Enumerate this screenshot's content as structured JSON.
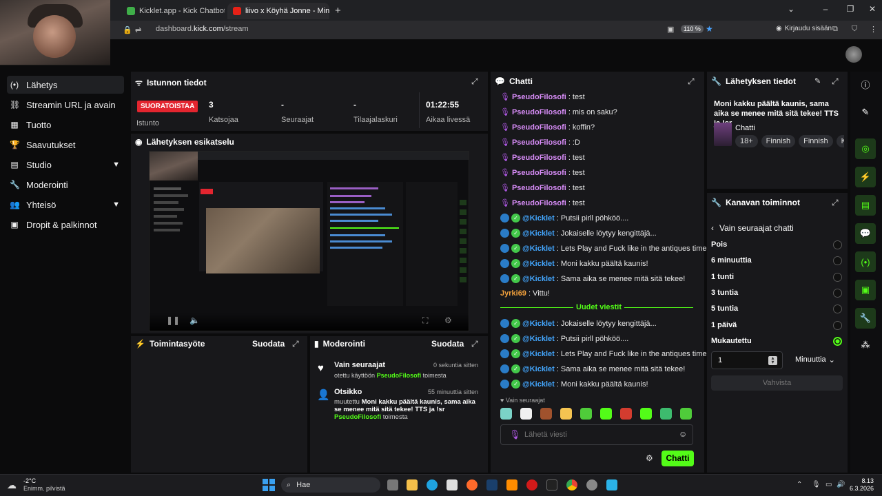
{
  "browser": {
    "tabs": [
      {
        "title": "Kicklet.app - Kick Chatbot and C"
      },
      {
        "title": "liivo x Köyhä Jonne - Minä S"
      }
    ],
    "url_prefix": "dashboard.",
    "url_domain": "kick.com",
    "url_path": "/stream",
    "zoom": "110 %",
    "signin": "Kirjaudu sisään"
  },
  "sidebar": {
    "items": [
      {
        "label": "Lähetys",
        "icon": "broadcast-icon"
      },
      {
        "label": "Streamin URL ja avain",
        "icon": "link-icon"
      },
      {
        "label": "Tuotto",
        "icon": "revenue-icon"
      },
      {
        "label": "Saavutukset",
        "icon": "trophy-icon"
      },
      {
        "label": "Studio",
        "icon": "studio-icon"
      },
      {
        "label": "Moderointi",
        "icon": "wrench-icon"
      },
      {
        "label": "Yhteisö",
        "icon": "community-icon"
      },
      {
        "label": "Dropit & palkinnot",
        "icon": "drops-icon"
      }
    ]
  },
  "session": {
    "title": "Istunnon tiedot",
    "live_badge": "SUORATOISTAA",
    "session_label": "Istunto",
    "stats": [
      {
        "value": "3",
        "label": "Katsojaa"
      },
      {
        "value": "-",
        "label": "Seuraajat"
      },
      {
        "value": "-",
        "label": "Tilaajalaskuri"
      },
      {
        "value": "01:22:55",
        "label": "Aikaa livessä"
      }
    ]
  },
  "preview": {
    "title": "Lähetyksen esikatselu"
  },
  "activity": {
    "title": "Toimintasyöte",
    "filter": "Suodata"
  },
  "moderation": {
    "title": "Moderointi",
    "filter": "Suodata",
    "events": [
      {
        "title": "Vain seuraajat",
        "time": "0 sekuntia sitten",
        "text_prefix": "otettu käyttöön",
        "user": "PseudoFilosofi",
        "text_suffix": "toimesta"
      },
      {
        "title": "Otsikko",
        "time": "55 minuuttia sitten",
        "text_prefix": "muutettu",
        "bold_text": "Moni kakku päältä kaunis, sama aika se menee mitä sitä tekee! TTS ja !sr",
        "user": "PseudoFilosofi",
        "text_suffix": "toimesta"
      }
    ]
  },
  "chat": {
    "title": "Chatti",
    "messages": [
      {
        "user": "PseudoFilosofi",
        "text": ": test",
        "type": "purple"
      },
      {
        "user": "PseudoFilosofi",
        "text": ": mis on saku?",
        "type": "purple"
      },
      {
        "user": "PseudoFilosofi",
        "text": ": koffin?",
        "type": "purple"
      },
      {
        "user": "PseudoFilosofi",
        "text": ": :D",
        "type": "purple"
      },
      {
        "user": "PseudoFilosofi",
        "text": ": test",
        "type": "purple"
      },
      {
        "user": "PseudoFilosofi",
        "text": ": test",
        "type": "purple"
      },
      {
        "user": "PseudoFilosofi",
        "text": ": test",
        "type": "purple"
      },
      {
        "user": "PseudoFilosofi",
        "text": ": test",
        "type": "purple"
      },
      {
        "user": "@Kicklet",
        "text": ": Putsii pirll pöhköö....",
        "type": "bot"
      },
      {
        "user": "@Kicklet",
        "text": ": Jokaiselle löytyy kengittäjä...",
        "type": "bot"
      },
      {
        "user": "@Kicklet",
        "text": ": Lets Play and Fuck like in the antiques times!",
        "type": "bot"
      },
      {
        "user": "@Kicklet",
        "text": ": Moni kakku päältä kaunis!",
        "type": "bot"
      },
      {
        "user": "@Kicklet",
        "text": ": Sama aika se menee mitä sitä tekee!",
        "type": "bot"
      },
      {
        "user": "Jyrki69",
        "text": ": Vittu!",
        "type": "orange"
      }
    ],
    "new_messages_label": "Uudet viestit",
    "new_messages": [
      {
        "user": "@Kicklet",
        "text": ": Jokaiselle löytyy kengittäjä..."
      },
      {
        "user": "@Kicklet",
        "text": ": Putsii pirll pöhköö...."
      },
      {
        "user": "@Kicklet",
        "text": ": Lets Play and Fuck like in the antiques times!"
      },
      {
        "user": "@Kicklet",
        "text": ": Sama aika se menee mitä sitä tekee!"
      },
      {
        "user": "@Kicklet",
        "text": ": Moni kakku päältä kaunis!"
      }
    ],
    "followers_only": "Vain seuraajat",
    "input_placeholder": "Lähetä viesti",
    "send_button": "Chatti"
  },
  "broadcast_info": {
    "title": "Lähetyksen tiedot",
    "stream_title": "Moni kakku päältä kaunis, sama aika se menee mitä sitä tekee! TTS ja !sr",
    "category": "Chatti",
    "tags": [
      "18+",
      "Finnish",
      "Finnish",
      "K"
    ]
  },
  "channel_actions": {
    "title": "Kanavan toiminnot",
    "subtitle": "Vain seuraajat chatti",
    "options": [
      {
        "label": "Pois",
        "selected": false
      },
      {
        "label": "6 minuuttia",
        "selected": false
      },
      {
        "label": "1 tunti",
        "selected": false
      },
      {
        "label": "3 tuntia",
        "selected": false
      },
      {
        "label": "5 tuntia",
        "selected": false
      },
      {
        "label": "1 päivä",
        "selected": false
      },
      {
        "label": "Mukautettu",
        "selected": true
      }
    ],
    "custom_value": "1",
    "unit": "Minuuttia",
    "confirm": "Vahvista"
  },
  "taskbar": {
    "weather_temp": "-2°C",
    "weather_desc": "Enimm. pilvistä",
    "search": "Hae",
    "time": "8.13",
    "date": "6.3.2026"
  },
  "colors": {
    "accent": "#53fc18",
    "live": "#e3252f",
    "panel": "#18181b"
  }
}
